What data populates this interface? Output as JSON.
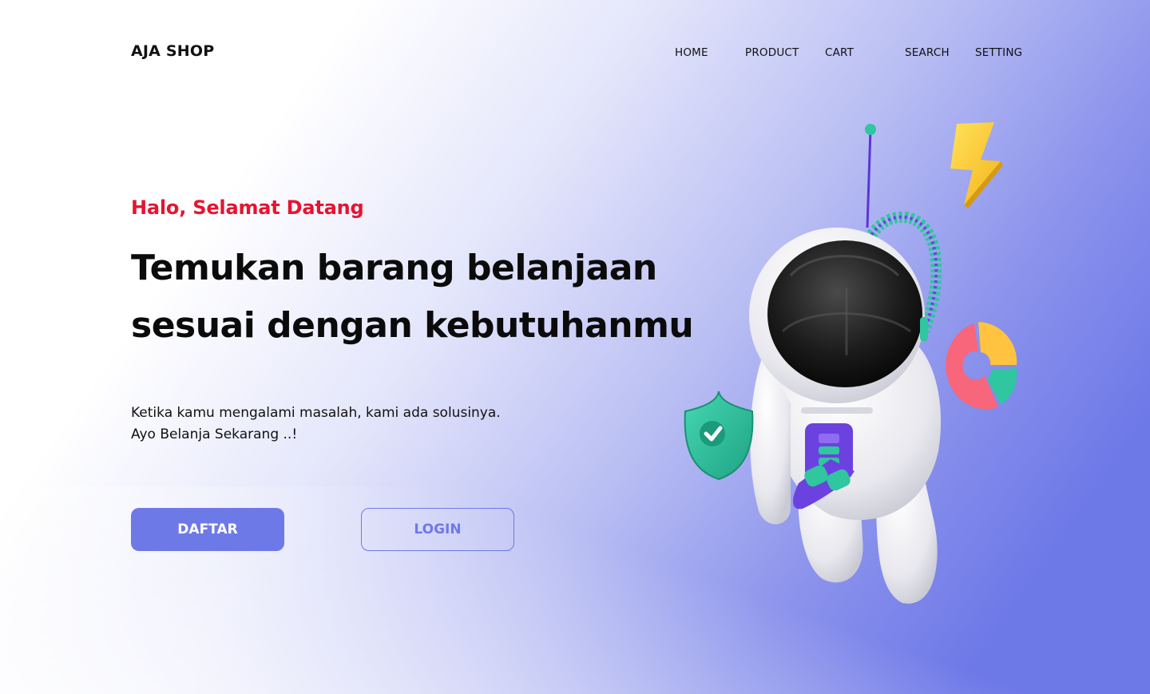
{
  "brand": {
    "name": "AJA SHOP"
  },
  "nav": {
    "items": [
      {
        "label": "HOME"
      },
      {
        "label": "PRODUCT"
      },
      {
        "label": "CART"
      },
      {
        "label": "SEARCH"
      },
      {
        "label": "SETTING"
      }
    ]
  },
  "hero": {
    "eyebrow": "Halo, Selamat Datang",
    "headline_lines": [
      "Temukan barang belanjaan",
      "sesuai dengan kebutuhanmu"
    ],
    "description_lines": [
      "Ketika kamu mengalami masalah, kami ada solusinya.",
      "Ayo Belanja Sekarang ..!"
    ]
  },
  "buttons": {
    "primary_label": "DAFTAR",
    "secondary_label": "LOGIN"
  },
  "illustration": {
    "figure": "astronaut",
    "icons": [
      "lightning-icon",
      "shield-check-icon",
      "pie-chart-icon"
    ]
  },
  "colors": {
    "accent": "#6e79e8",
    "eyebrow": "#e8132f",
    "text": "#0b0b0b",
    "shield": "#2fc6a0",
    "lightning": "#ffcf33",
    "pie_red": "#f7667a",
    "pie_yellow": "#ffc340",
    "pie_teal": "#2fc6a0"
  }
}
